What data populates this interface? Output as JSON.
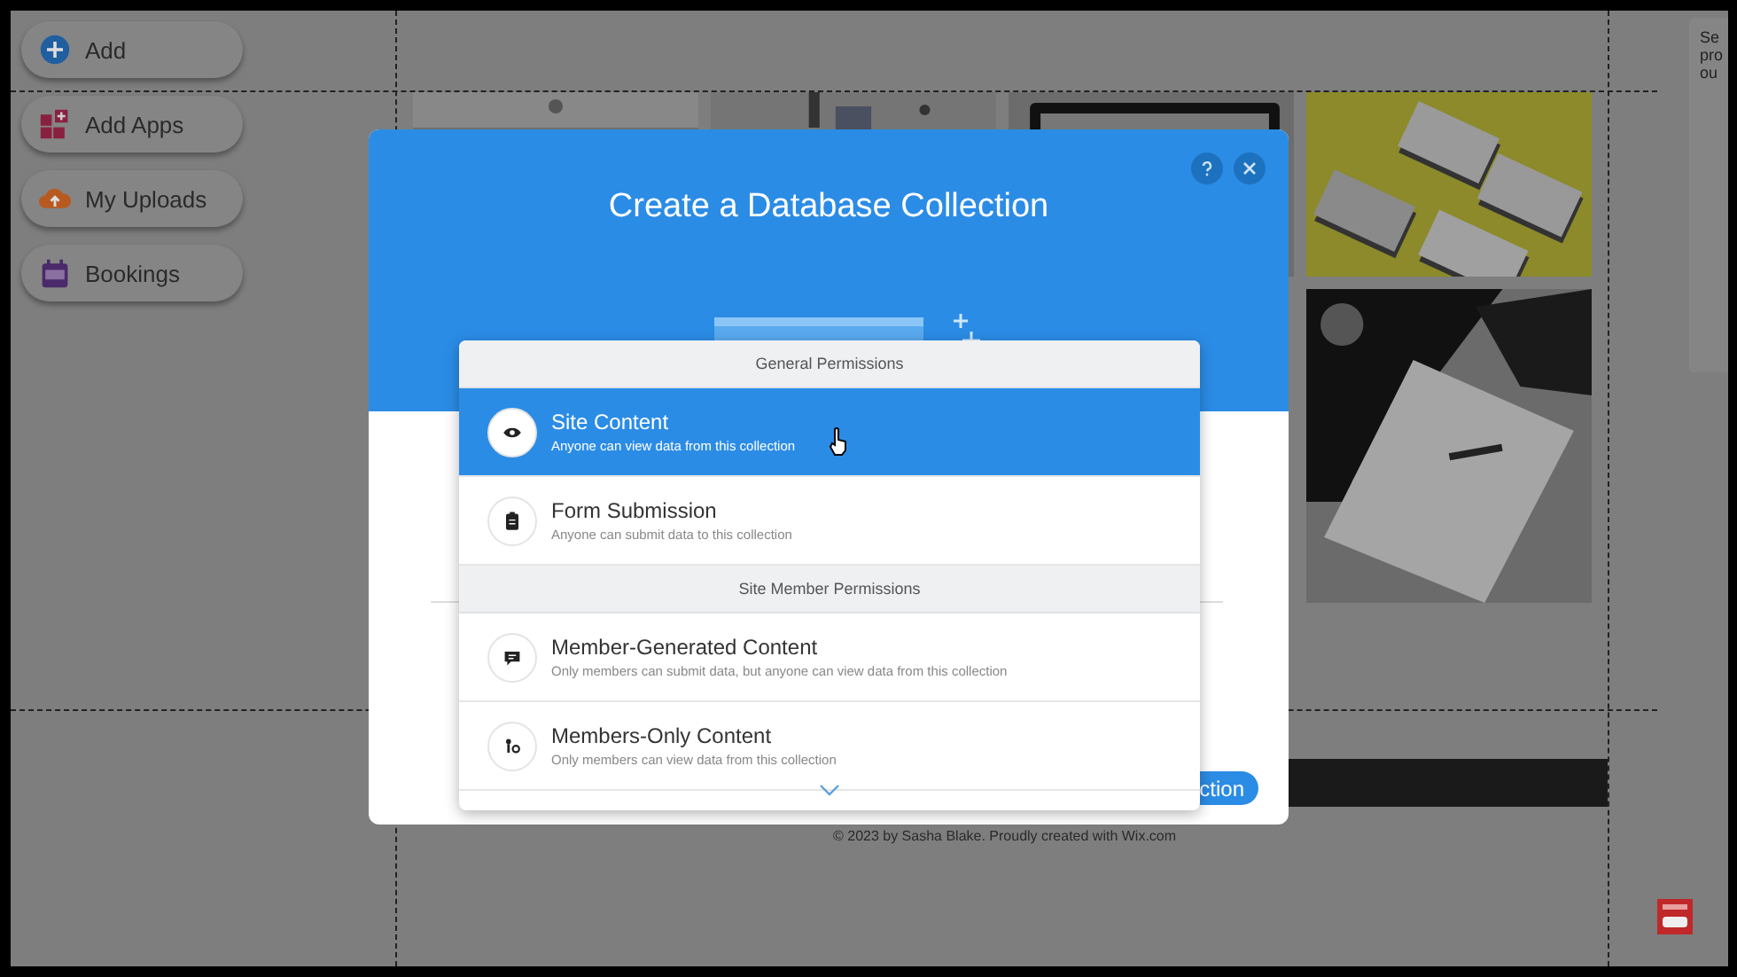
{
  "sidebar": {
    "items": [
      {
        "label": "Add",
        "kind": "add"
      },
      {
        "label": "Add Apps",
        "kind": "apps"
      },
      {
        "label": "My Uploads",
        "kind": "uploads"
      },
      {
        "label": "Bookings",
        "kind": "bookings"
      }
    ]
  },
  "right_panel": {
    "lines": [
      "Se",
      "pro",
      "ou"
    ]
  },
  "footer": {
    "text": "© 2023 by Sasha Blake. Proudly created with Wix.com"
  },
  "modal": {
    "title": "Create a Database Collection",
    "primary_button": "ction",
    "permissions": [
      {
        "header": "General Permissions",
        "options": [
          {
            "title": "Site Content",
            "description": "Anyone can view data from this collection",
            "selected": true,
            "kind": "eye"
          },
          {
            "title": "Form Submission",
            "description": "Anyone can submit data to this collection",
            "selected": false,
            "kind": "clipboard"
          }
        ]
      },
      {
        "header": "Site Member Permissions",
        "options": [
          {
            "title": "Member-Generated Content",
            "description": "Only members can submit data, but anyone can view data from this collection",
            "selected": false,
            "kind": "chat"
          },
          {
            "title": "Members-Only Content",
            "description": "Only members can view data from this collection",
            "selected": false,
            "kind": "member"
          }
        ]
      }
    ]
  }
}
